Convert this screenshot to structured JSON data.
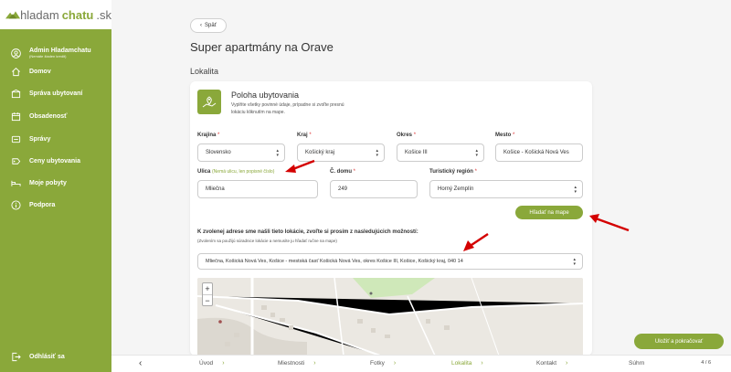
{
  "logo": {
    "part1": "hladam",
    "part2": "chatu",
    "part3": ".sk"
  },
  "sidebar": {
    "user": {
      "name": "Admin Hladamchatu",
      "sub": "(Nemáte žiaden kredit)"
    },
    "items": [
      {
        "label": "Domov",
        "icon": "home-icon"
      },
      {
        "label": "Správa ubytovaní",
        "icon": "building-icon"
      },
      {
        "label": "Obsadenosť",
        "icon": "calendar-icon"
      },
      {
        "label": "Správy",
        "icon": "message-icon"
      },
      {
        "label": "Ceny ubytovania",
        "icon": "price-icon"
      },
      {
        "label": "Moje pobyty",
        "icon": "bed-icon"
      },
      {
        "label": "Podpora",
        "icon": "info-icon"
      }
    ],
    "logout": "Odhlásiť sa"
  },
  "main": {
    "back": "Späť",
    "title": "Super apartmány na Orave",
    "section": "Lokalita"
  },
  "card": {
    "title": "Poloha ubytovania",
    "desc": "Vyplňte všetky povinné údaje, prípadne si zvoľte presnú lokáciu kliknutím na mape.",
    "fields": {
      "country": {
        "label": "Krajina",
        "value": "Slovensko"
      },
      "region": {
        "label": "Kraj",
        "value": "Košický kraj"
      },
      "district": {
        "label": "Okres",
        "value": "Košice III"
      },
      "city": {
        "label": "Mesto",
        "value": "Košice - Košická Nová Ves"
      },
      "street": {
        "label": "Ulica",
        "hint": "(Nemá ulicu, len popisné číslo)",
        "value": "Mliečna"
      },
      "number": {
        "label": "Č. domu",
        "value": "249"
      },
      "tourist": {
        "label": "Turistický región",
        "value": "Horný Zemplín"
      }
    },
    "search_button": "Hľadať na mape",
    "found_title": "K zvolenej adrese sme našli tieto lokácie, zvoľte si prosím z nasledujúcich možností:",
    "found_sub": "(Zvolením sa použijú súradnice lokácie a nemusíte ju hľadať ručne na mape)",
    "address_option": "Mliečna, Košická Nová Ves, Košice - mestská časť Košická Nová Ves, okres Košice III, Košice, Košický kraj, 040 14",
    "zoom_in": "+",
    "zoom_out": "−"
  },
  "save_button": "Uložiť a pokračovať",
  "bottomnav": {
    "prev": "‹",
    "steps": [
      "Úvod",
      "Miestnosti",
      "Fotky",
      "Lokalita",
      "Kontakt",
      "Súhrn"
    ],
    "active_step": "Lokalita",
    "page": "4 / 6"
  },
  "colors": {
    "accent": "#8aa83a",
    "annotation": "#d40000"
  }
}
